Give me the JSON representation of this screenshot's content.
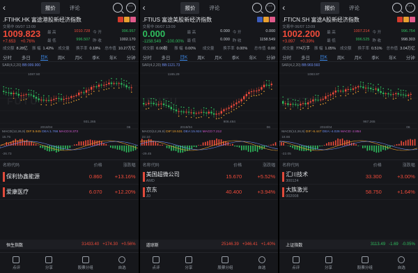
{
  "colors": {
    "up": "#f04b3a",
    "down": "#2fbf5e",
    "accent": "#3d8df0",
    "bg": "#16171b"
  },
  "panels": [
    {
      "tabs": [
        "报价",
        "评论"
      ],
      "ticker": ".FTIHK.HK 富途港股新经济指数",
      "flags": [
        "#d33a2c",
        "#e8a030",
        "#e15a8a"
      ],
      "time": "交易中 06/07 13:09",
      "price": "1009.823",
      "price_dir": "up",
      "change": "+7.653",
      "change_pct": "+0.76%",
      "stats": [
        {
          "label": "最 高",
          "value": "1010.728",
          "dir": "up"
        },
        {
          "label": "今 开",
          "value": "996.957",
          "dir": "down"
        },
        {
          "label": "最 低",
          "value": "996.507",
          "dir": "down"
        },
        {
          "label": "昨 收",
          "value": "1002.170",
          "dir": "neutral"
        }
      ],
      "bottom": [
        {
          "label": "成交额",
          "value": "8.28亿"
        },
        {
          "label": "振 幅",
          "value": "1.42%"
        },
        {
          "label": "成交量",
          "value": ""
        },
        {
          "label": "换手率",
          "value": "0.18%"
        },
        {
          "label": "总市值",
          "value": "10.27万亿"
        }
      ],
      "periods": [
        "分时",
        "多日",
        "日K",
        "周K",
        "月K",
        "季K",
        "年K",
        "分钟"
      ],
      "active_period": 2,
      "sar_label": "SAR(4,2,20)",
      "sar_value": "BB:999.900",
      "chart_high": "1087.50",
      "chart_low": "931.265",
      "date": "2018/04",
      "date2": "06",
      "macd_label": "MACD(12,26,9)",
      "macd_dif": "DIF:5.945",
      "macd_dea": "DEA:1.766",
      "macd_val": "MACD:8.373",
      "macd_top": "15.75",
      "macd_bot": "-26.73",
      "list_headers": [
        "名称代码",
        "价格",
        "涨跌幅"
      ],
      "rows": [
        {
          "name": "保利协鑫能源",
          "code": "",
          "price": "0.860",
          "pct": "+13.16%",
          "dir": "up"
        },
        {
          "name": "爱康医疗",
          "code": "",
          "price": "6.070",
          "pct": "+12.20%",
          "dir": "up"
        }
      ],
      "index": {
        "name": "恒生指数",
        "value": "31433.40",
        "change": "+174.30",
        "pct": "+0.56%",
        "dir": "up"
      },
      "nav": [
        "点评",
        "分享",
        "股票分组",
        "自选"
      ]
    },
    {
      "tabs": [
        "报价",
        "评论"
      ],
      "ticker": ".FTIUS 富途美股新经济指数",
      "flags": [
        "#3b5bbb",
        "#e8a030",
        "#e15a8a"
      ],
      "time": "交易中 06/07 13:09",
      "price": "0.000",
      "price_dir": "down",
      "change": "-1158.549",
      "change_pct": "-100.00%",
      "stats": [
        {
          "label": "最 高",
          "value": "0.000",
          "dir": "neutral"
        },
        {
          "label": "今 开",
          "value": "0.000",
          "dir": "neutral"
        },
        {
          "label": "最 低",
          "value": "0.000",
          "dir": "neutral"
        },
        {
          "label": "昨 收",
          "value": "1158.549",
          "dir": "neutral"
        }
      ],
      "bottom": [
        {
          "label": "成交额",
          "value": "0.00股"
        },
        {
          "label": "振 幅",
          "value": "0.00%"
        },
        {
          "label": "成交量",
          "value": ""
        },
        {
          "label": "换手率",
          "value": "0.00%"
        },
        {
          "label": "总市值",
          "value": "0.00"
        }
      ],
      "periods": [
        "分时",
        "多日",
        "日K",
        "周K",
        "月K",
        "季K",
        "年K",
        "分钟"
      ],
      "active_period": 2,
      "sar_label": "SAR(4,2,20)",
      "sar_value": "BB:1121.73",
      "chart_high": "1165.29",
      "chart_low": "906.484",
      "date": "2018/04",
      "date2": "06",
      "macd_label": "MACD(12,26,9)",
      "macd_dif": "DIF:19.531",
      "macd_dea": "DEA:15.924",
      "macd_val": "MACD:7.212",
      "macd_top": "22.10",
      "macd_bot": "-29.45",
      "list_headers": [
        "名称代码",
        "价格",
        "涨跌幅"
      ],
      "rows": [
        {
          "name": "美国超微公司",
          "code": "AMD",
          "price": "15.670",
          "pct": "+5.52%",
          "dir": "up"
        },
        {
          "name": "京东",
          "code": "JD",
          "price": "40.400",
          "pct": "+3.94%",
          "dir": "up"
        }
      ],
      "index": {
        "name": "道琼斯",
        "value": "25146.39",
        "change": "+346.41",
        "pct": "+1.40%",
        "dir": "up"
      },
      "nav": [
        "点评",
        "分享",
        "股票分组",
        "自选"
      ]
    },
    {
      "tabs": [
        "报价",
        "评论"
      ],
      "ticker": ".FTICN.SH 富途A股新经济指数",
      "flags": [
        "#d33a2c",
        "#e8a030",
        "#e15a8a"
      ],
      "time": "交易中 06/07 13:09",
      "price": "1002.200",
      "price_dir": "up",
      "change": "+3.897",
      "change_pct": "+0.39%",
      "stats": [
        {
          "label": "最 高",
          "value": "1007.214",
          "dir": "up"
        },
        {
          "label": "今 开",
          "value": "996.754",
          "dir": "down"
        },
        {
          "label": "最 低",
          "value": "996.525",
          "dir": "down"
        },
        {
          "label": "昨 收",
          "value": "998.303",
          "dir": "neutral"
        }
      ],
      "bottom": [
        {
          "label": "成交量",
          "value": "774万手"
        },
        {
          "label": "振 幅",
          "value": "1.05%"
        },
        {
          "label": "成交额",
          "value": ""
        },
        {
          "label": "换手率",
          "value": "0.51%"
        },
        {
          "label": "总市值",
          "value": "3.04万亿"
        }
      ],
      "periods": [
        "分时",
        "多日",
        "日K",
        "周K",
        "月K",
        "季K",
        "年K",
        "分钟"
      ],
      "active_period": 2,
      "sar_label": "SAR(4,2,20)",
      "sar_value": "BB:969.560",
      "chart_high": "1083.97",
      "chart_low": "967.265",
      "date": "2018/04",
      "date2": "06",
      "macd_label": "MACD(12,26,9)",
      "macd_dif": "DIF:-6.447",
      "macd_dea": "DEA:-4.026",
      "macd_val": "MACD:-2.854",
      "macd_top": "18.66",
      "macd_bot": "-22.05",
      "list_headers": [
        "名称代码",
        "价格",
        "涨跌幅"
      ],
      "rows": [
        {
          "name": "汇川技术",
          "code": "300124",
          "price": "33.300",
          "pct": "+3.00%",
          "dir": "up"
        },
        {
          "name": "大族激光",
          "code": "002008",
          "price": "58.750",
          "pct": "+1.64%",
          "dir": "up"
        }
      ],
      "index": {
        "name": "上证指数",
        "value": "3113.49",
        "change": "-1.69",
        "pct": "-0.05%",
        "dir": "down"
      },
      "nav": [
        "点评",
        "分享",
        "股票分组",
        "自选"
      ]
    }
  ]
}
